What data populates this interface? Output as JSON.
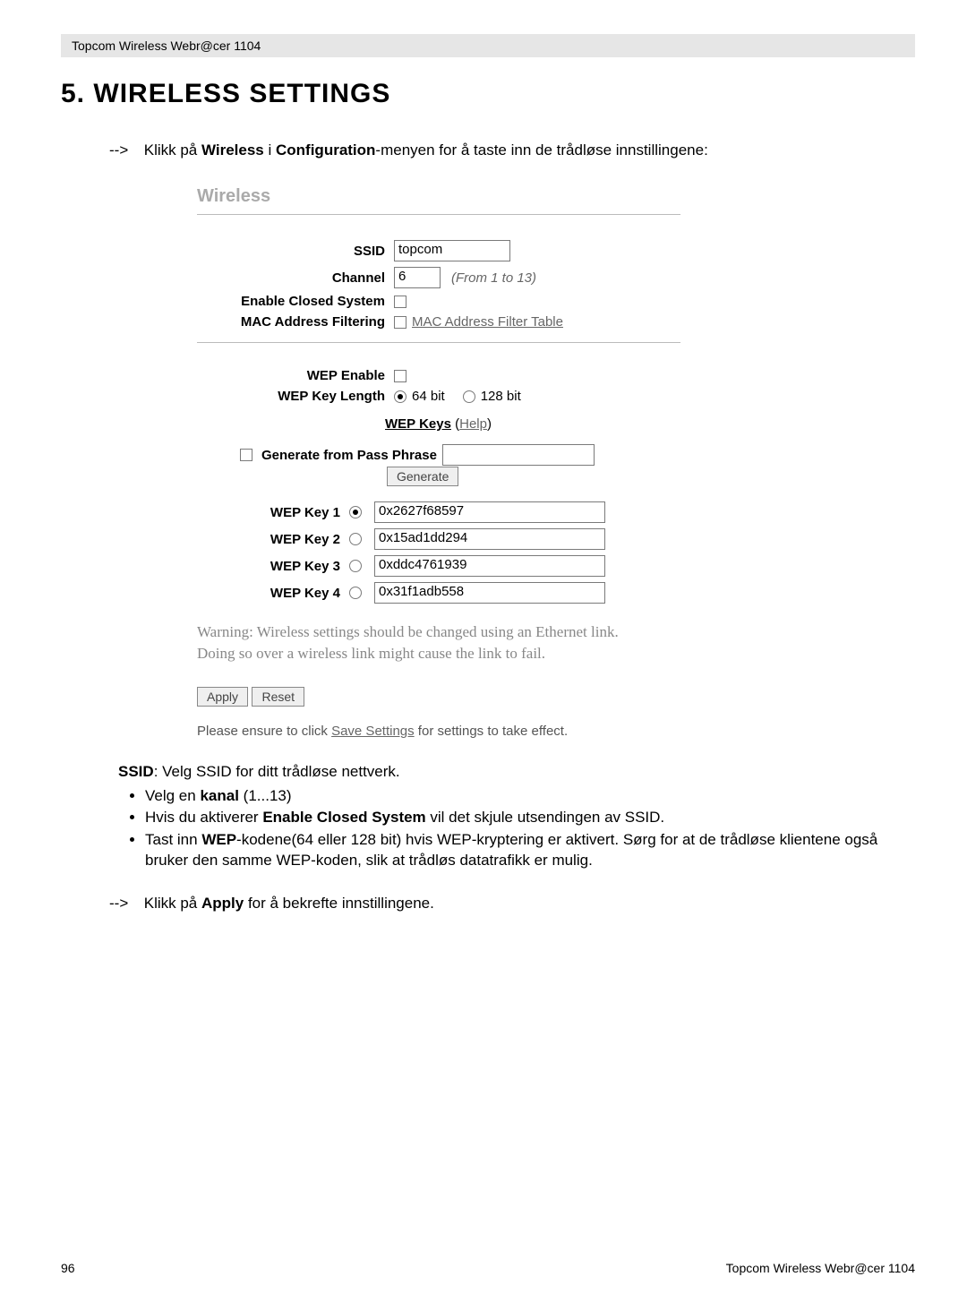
{
  "header": {
    "product": "Topcom Wireless Webr@cer 1104"
  },
  "section": {
    "number": "5.",
    "title": "WIRELESS SETTINGS"
  },
  "intro": {
    "arrow": "-->",
    "pre": "Klikk på ",
    "b1": "Wireless",
    "mid": " i ",
    "b2": "Configuration",
    "post": "-menyen for å taste inn de trådløse innstillingene:"
  },
  "scr": {
    "heading": "Wireless",
    "labels": {
      "ssid": "SSID",
      "channel": "Channel",
      "channel_hint": "(From 1 to 13)",
      "closed": "Enable Closed System",
      "mac": "MAC Address Filtering",
      "mac_link": "MAC Address Filter Table",
      "wep_enable": "WEP Enable",
      "wep_len": "WEP Key Length",
      "len64": "64 bit",
      "len128": "128 bit",
      "wep_keys": "WEP Keys",
      "help": "Help",
      "gen_label": "Generate from Pass Phrase",
      "gen_btn": "Generate",
      "k1": "WEP Key 1",
      "k2": "WEP Key 2",
      "k3": "WEP Key 3",
      "k4": "WEP Key 4",
      "apply": "Apply",
      "reset": "Reset"
    },
    "values": {
      "ssid": "topcom",
      "channel": "6",
      "passphrase": "",
      "k1": "0x2627f68597",
      "k2": "0x15ad1dd294",
      "k3": "0xddc4761939",
      "k4": "0x31f1adb558"
    },
    "warning1": "Warning: Wireless settings should be changed using an Ethernet link.",
    "warning2": "Doing so over a wireless link might cause the link to fail.",
    "please_pre": "Please ensure to click ",
    "save_link": "Save Settings",
    "please_post": " for settings to take effect."
  },
  "body": {
    "ssid_b": "SSID",
    "ssid_t": ": Velg SSID for ditt trådløse nettverk.",
    "li1_pre": "Velg en ",
    "li1_b": "kanal",
    "li1_post": " (1...13)",
    "li2_pre": "Hvis du aktiverer ",
    "li2_b": "Enable Closed System",
    "li2_post": " vil det skjule utsendingen av SSID.",
    "li3_pre": "Tast inn ",
    "li3_b": "WEP",
    "li3_post": "-kodene(64 eller 128 bit) hvis WEP-kryptering er aktivert. Sørg for at de trådløse klientene også bruker den samme WEP-koden, slik at trådløs datatrafikk er mulig."
  },
  "apply_line": {
    "arrow": "-->",
    "pre": "Klikk på ",
    "b": "Apply",
    "post": " for å bekrefte innstillingene."
  },
  "footer": {
    "page": "96",
    "product": "Topcom Wireless Webr@cer 1104"
  }
}
